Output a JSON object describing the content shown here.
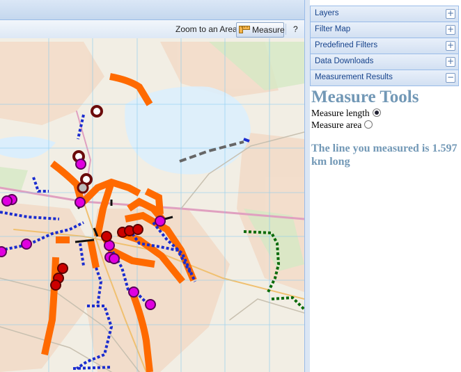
{
  "toolbar": {
    "zoom_area_label": "Zoom to an Area",
    "measure_label": "Measure",
    "help_label": "?"
  },
  "sidebar": {
    "sections": [
      {
        "label": "Layers",
        "toggle": "+"
      },
      {
        "label": "Filter Map",
        "toggle": "+"
      },
      {
        "label": "Predefined Filters",
        "toggle": "+"
      },
      {
        "label": "Data Downloads",
        "toggle": "+"
      },
      {
        "label": "Measurement Results",
        "toggle": "−"
      }
    ]
  },
  "measure": {
    "title": "Measure Tools",
    "option_length": "Measure length",
    "option_area": "Measure area",
    "selected": "length",
    "result": "The line you measured is 1.597 km long"
  },
  "colors": {
    "route_orange": "#ff6a00",
    "route_blue": "#1a2ccf",
    "route_green": "#0b6b0b",
    "marker_magenta": "#e000e0",
    "marker_red": "#cc0000",
    "marker_dark": "#6b0b0b",
    "header_text": "#15428b",
    "measure_text": "#7298b6"
  }
}
